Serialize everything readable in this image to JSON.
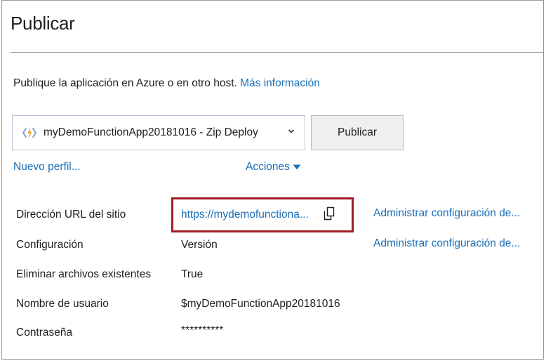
{
  "header": {
    "title": "Publicar"
  },
  "intro": {
    "text": "Publique la aplicación en Azure o en otro host.",
    "more_link": "Más información"
  },
  "profile": {
    "selected": "myDemoFunctionApp20181016 - Zip Deploy",
    "icon": "azure-function-icon",
    "publish_label": "Publicar",
    "new_profile_link": "Nuevo perfil...",
    "actions_label": "Acciones"
  },
  "properties": [
    {
      "label": "Dirección URL del sitio",
      "value": "https://mydemofunctiona...",
      "manage_link": "Administrar configuración de..."
    },
    {
      "label": "Configuración",
      "value": "Versión",
      "manage_link": "Administrar configuración de..."
    },
    {
      "label": "Eliminar archivos existentes",
      "value": "True"
    },
    {
      "label": "Nombre de usuario",
      "value": "$myDemoFunctionApp20181016"
    },
    {
      "label": "Contraseña",
      "value": "**********"
    }
  ],
  "colors": {
    "link": "#1a6fb8",
    "highlight_border": "#a21b25",
    "function_icon": "#f5a623"
  }
}
